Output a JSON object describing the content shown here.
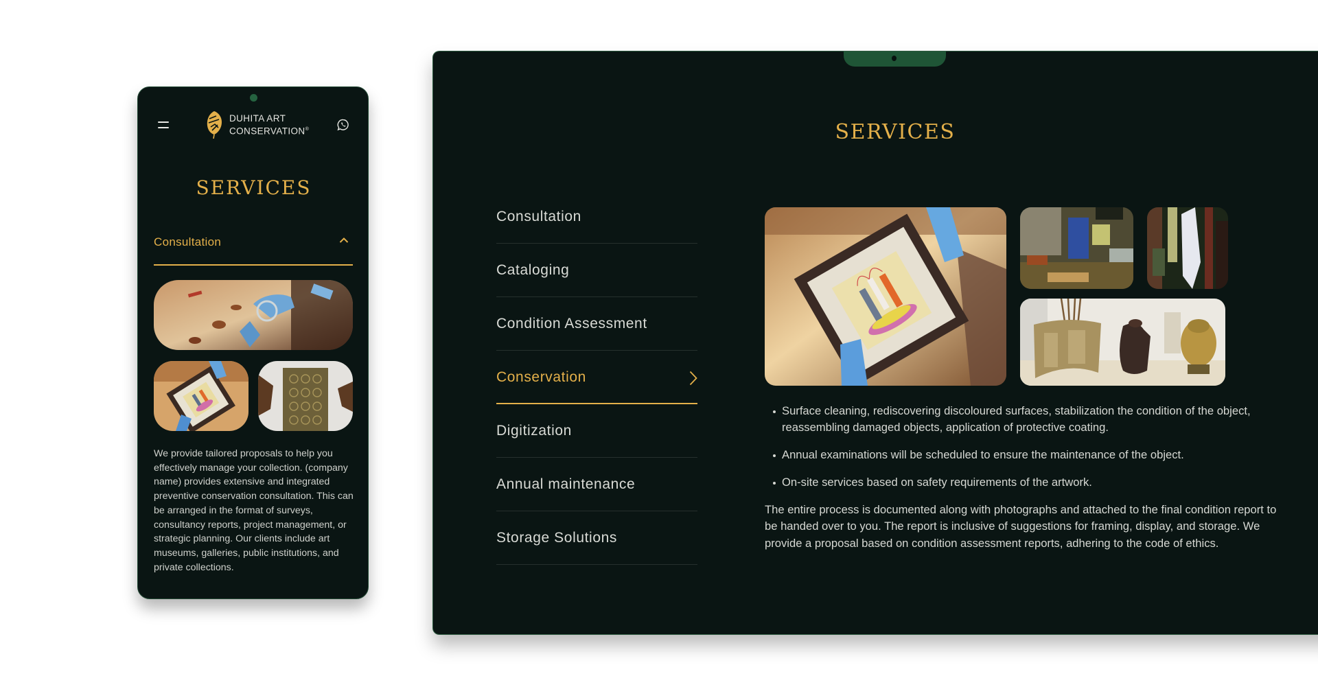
{
  "brand": {
    "name_line1": "DUHITA ART",
    "name_line2": "CONSERVATION",
    "registered_mark": "®",
    "gold": "#e4b04a",
    "background": "#0a1513",
    "accent_green": "#1f5536"
  },
  "mobile": {
    "header": {
      "menu_icon": "hamburger-icon",
      "contact_icon": "whatsapp-icon"
    },
    "title": "SERVICES",
    "accordion": {
      "label": "Consultation",
      "expanded": true,
      "chevron_icon": "chevron-up-icon"
    },
    "images": [
      {
        "alt": "Conservator examining miniature musical instruments with a magnifier"
      },
      {
        "alt": "Gloved hands holding a framed painting"
      },
      {
        "alt": "Engraved brass panel"
      }
    ],
    "description": "We provide tailored proposals to help you effectively manage your collection. (company name)  provides extensive and integrated preventive conservation consultation. This can be arranged in the format of surveys, consultancy reports, project management, or strategic planning. Our clients include art museums, galleries, public institutions, and private collections."
  },
  "desktop": {
    "title": "SERVICES",
    "services": [
      {
        "label": "Consultation",
        "active": false
      },
      {
        "label": "Cataloging",
        "active": false
      },
      {
        "label": "Condition Assessment",
        "active": false
      },
      {
        "label": "Conservation",
        "active": true
      },
      {
        "label": "Digitization",
        "active": false
      },
      {
        "label": "Annual maintenance",
        "active": false
      },
      {
        "label": "Storage Solutions",
        "active": false
      }
    ],
    "images": [
      {
        "alt": "Gloved hands holding a framed miniature painting"
      },
      {
        "alt": "Detail of an oil painting with blue and yellow strokes"
      },
      {
        "alt": "Detail of impasto paint texture"
      },
      {
        "alt": "Brass and bronze artefacts on a shelf"
      }
    ],
    "bullets": [
      "Surface cleaning, rediscovering discoloured surfaces, stabilization the condition of the object, reassembling damaged objects, application of protective coating.",
      "Annual examinations will be scheduled to ensure the maintenance of the object.",
      "On-site services based on safety requirements of the artwork."
    ],
    "paragraph": "The entire process is documented along with photographs and attached to the final condition report to be handed over to you. The report is inclusive of suggestions for framing, display, and storage. We provide a proposal based on condition assessment reports, adhering to the code of ethics."
  }
}
